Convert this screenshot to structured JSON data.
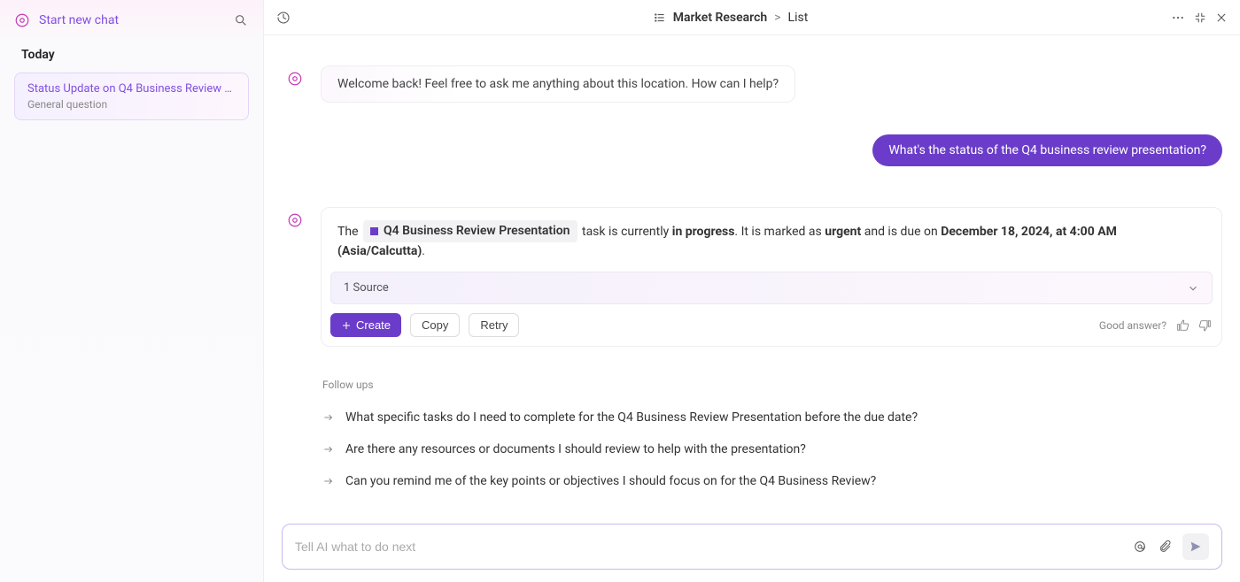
{
  "sidebar": {
    "start_chat": "Start new chat",
    "today_label": "Today",
    "active_chat": {
      "title": "Status Update on Q4 Business Review P...",
      "subtitle": "General question"
    }
  },
  "header": {
    "breadcrumb_a": "Market Research",
    "breadcrumb_sep": ">",
    "breadcrumb_b": "List"
  },
  "messages": {
    "welcome": "Welcome back! Feel free to ask me anything about this location. How can I help?",
    "user_q": "What's the status of the Q4 business review presentation?",
    "answer": {
      "pre": "The",
      "chip": "Q4 Business Review Presentation",
      "mid1": "task is currently",
      "status1": "in progress",
      "mid2": ". It is marked as",
      "status2": "urgent",
      "mid3": "and is due on",
      "due": "December 18, 2024, at 4:00 AM (Asia/Calcutta)",
      "tail": "."
    }
  },
  "source_bar": "1 Source",
  "buttons": {
    "create": "Create",
    "copy": "Copy",
    "retry": "Retry",
    "feedback": "Good answer?"
  },
  "followups": {
    "label": "Follow ups",
    "items": [
      "What specific tasks do I need to complete for the Q4 Business Review Presentation before the due date?",
      "Are there any resources or documents I should review to help with the presentation?",
      "Can you remind me of the key points or objectives I should focus on for the Q4 Business Review?"
    ]
  },
  "composer": {
    "placeholder": "Tell AI what to do next"
  }
}
